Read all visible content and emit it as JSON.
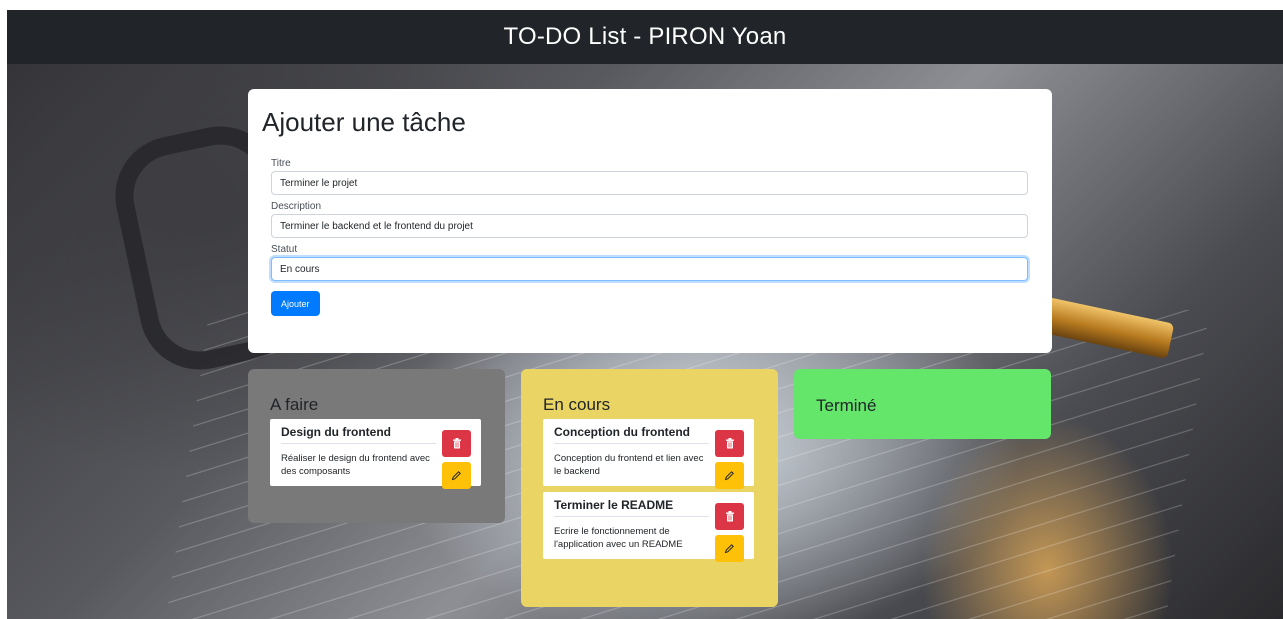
{
  "header": {
    "title": "TO-DO List - PIRON Yoan"
  },
  "form": {
    "heading": "Ajouter une tâche",
    "fields": [
      {
        "label": "Titre",
        "value": "Terminer le projet"
      },
      {
        "label": "Description",
        "value": "Terminer le backend et le frontend du projet"
      },
      {
        "label": "Statut",
        "value": "En cours"
      }
    ],
    "submit_label": "Ajouter"
  },
  "columns": [
    {
      "title": "A faire",
      "color": "#797979",
      "tasks": [
        {
          "title": "Design du frontend",
          "description": "Réaliser le design du frontend avec des composants"
        }
      ]
    },
    {
      "title": "En cours",
      "color": "#ead564",
      "tasks": [
        {
          "title": "Conception du frontend",
          "description": "Conception du frontend et lien avec le backend"
        },
        {
          "title": "Terminer le README",
          "description": "Ecrire le fonctionnement de l'application avec un README"
        }
      ]
    },
    {
      "title": "Terminé",
      "color": "#64e66a",
      "tasks": []
    }
  ],
  "icons": {
    "delete": "trash-icon",
    "edit": "pencil-icon"
  },
  "colors": {
    "header_bg": "#212529",
    "primary": "#007bff",
    "danger": "#dc3545",
    "warning": "#ffc107"
  }
}
